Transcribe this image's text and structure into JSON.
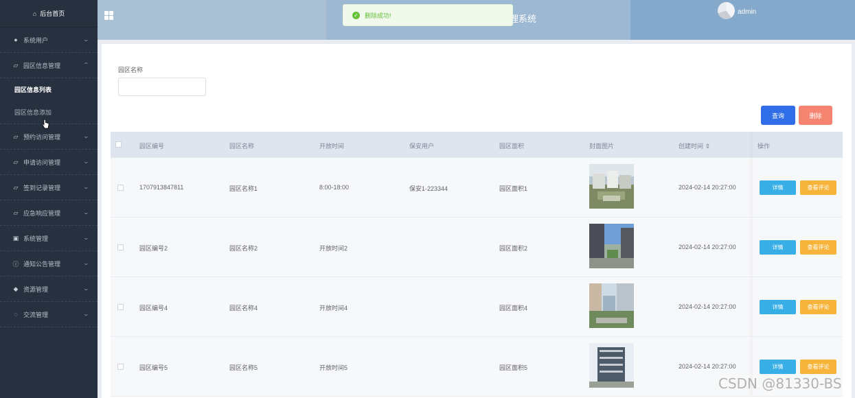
{
  "sidebar": {
    "home": "后台首页",
    "items": [
      {
        "label": "系统用户",
        "icon": "user-icon"
      },
      {
        "label": "园区信息管理",
        "icon": "folder-icon",
        "open": true
      },
      {
        "label": "预约访问管理",
        "icon": "folder-icon"
      },
      {
        "label": "申请访问管理",
        "icon": "folder-icon"
      },
      {
        "label": "签到记录管理",
        "icon": "folder-icon"
      },
      {
        "label": "应急响应管理",
        "icon": "folder-icon"
      },
      {
        "label": "系统管理",
        "icon": "image-icon"
      },
      {
        "label": "通知公告管理",
        "icon": "info-icon"
      },
      {
        "label": "资源管理",
        "icon": "location-icon"
      },
      {
        "label": "交流管理",
        "icon": "chat-icon"
      }
    ],
    "subitems": [
      {
        "label": "园区信息列表",
        "active": true
      },
      {
        "label": "园区信息添加",
        "active": false
      }
    ]
  },
  "header": {
    "system_title": "理系统",
    "username": "admin"
  },
  "toast": {
    "message": "删除成功!"
  },
  "filter": {
    "label": "园区名称",
    "value": "",
    "placeholder": ""
  },
  "buttons": {
    "query": "查询",
    "delete": "删除"
  },
  "table": {
    "columns": [
      "园区编号",
      "园区名称",
      "开放时间",
      "保安用户",
      "园区面积",
      "封面图片",
      "创建时间 ⇕",
      "操作"
    ],
    "rows": [
      {
        "code": "1707913847811",
        "name": "园区名称1",
        "open_time": "8:00-18:00",
        "guard": "保安1-223344",
        "area": "园区面积1",
        "created": "2024-02-14 20:27:00",
        "image": "aerial"
      },
      {
        "code": "园区编号2",
        "name": "园区名称2",
        "open_time": "开放时间2",
        "guard": "",
        "area": "园区面积2",
        "created": "2024-02-14 20:27:00",
        "image": "street"
      },
      {
        "code": "园区编号4",
        "name": "园区名称4",
        "open_time": "开放时间4",
        "guard": "",
        "area": "园区面积4",
        "created": "2024-02-14 20:27:00",
        "image": "plaza"
      },
      {
        "code": "园区编号5",
        "name": "园区名称5",
        "open_time": "开放时间5",
        "guard": "",
        "area": "园区面积5",
        "created": "2024-02-14 20:27:00",
        "image": "tower"
      }
    ],
    "detail_label": "详情",
    "review_label": "查看评论"
  },
  "watermark": "CSDN @81330-BS",
  "colors": {
    "sidebar_bg": "#27303f",
    "primary": "#2f6ee6",
    "danger": "#f58571",
    "info": "#37aee6",
    "warning": "#f7b43b",
    "success": "#67c23a"
  }
}
